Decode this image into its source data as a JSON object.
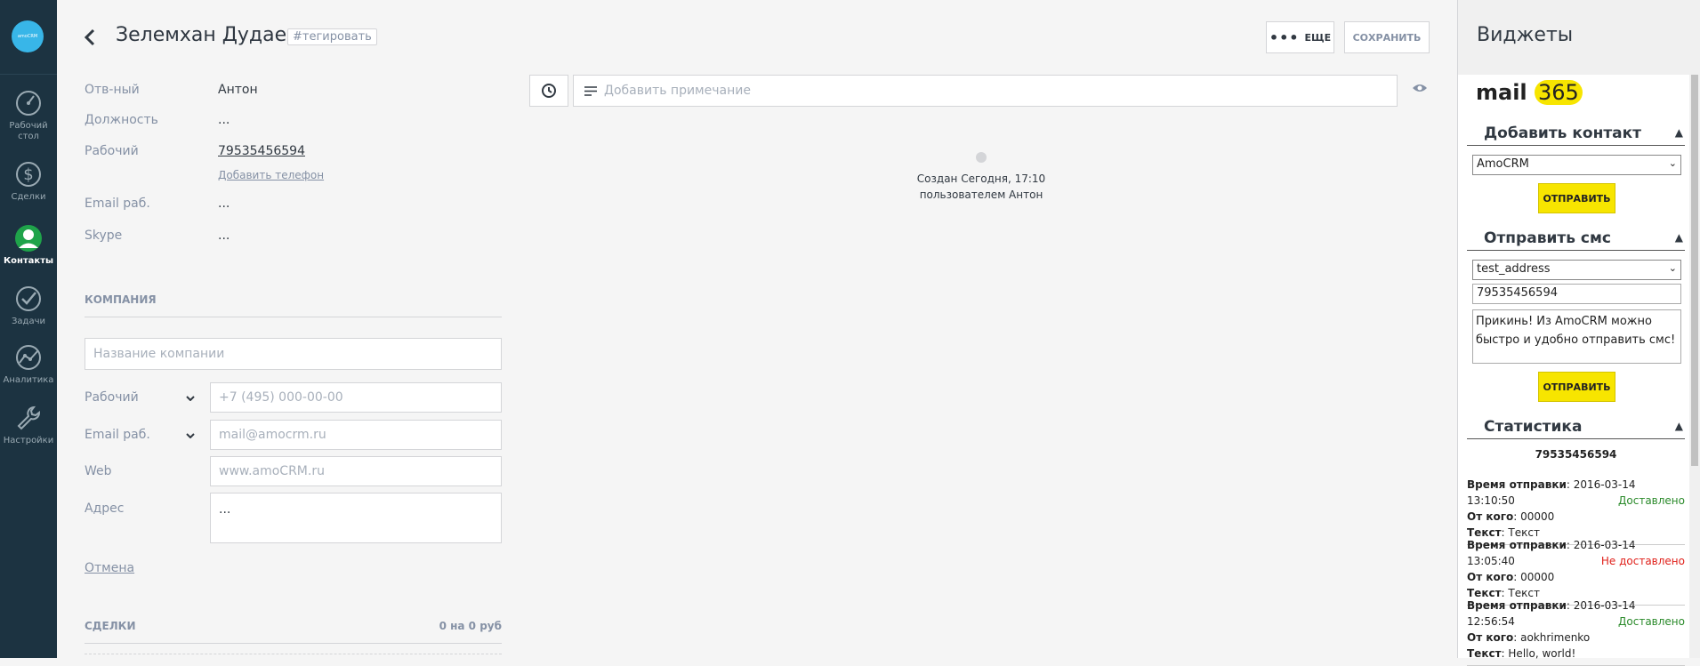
{
  "nav": {
    "logo_text": "amoCRM",
    "items": [
      {
        "label": "Рабочий стол",
        "icon": "dashboard-icon"
      },
      {
        "label": "Сделки",
        "icon": "dollar-icon"
      },
      {
        "label": "Контакты",
        "icon": "contact-icon"
      },
      {
        "label": "Задачи",
        "icon": "check-icon"
      },
      {
        "label": "Аналитика",
        "icon": "analytics-icon"
      },
      {
        "label": "Настройки",
        "icon": "wrench-icon"
      }
    ],
    "active_item": "Контакты"
  },
  "contact": {
    "name": "Зелемхан Дудаев",
    "tag_link": "#тегировать",
    "fields": [
      {
        "label": "Отв-ный",
        "value": "Антон"
      },
      {
        "label": "Должность",
        "value": "..."
      },
      {
        "label": "Рабочий",
        "value": "79535456594"
      },
      {
        "label": "Email раб.",
        "value": "..."
      },
      {
        "label": "Skype",
        "value": "..."
      }
    ],
    "add_phone": "Добавить телефон"
  },
  "company": {
    "heading": "КОМПАНИЯ",
    "name_placeholder": "Название компании",
    "phone_label": "Рабочий",
    "phone_placeholder": "+7 (495) 000-00-00",
    "email_label": "Email раб.",
    "email_placeholder": "mail@amocrm.ru",
    "web_label": "Web",
    "web_placeholder": "www.amoCRM.ru",
    "address_label": "Адрес",
    "address_value": "...",
    "cancel": "Отмена"
  },
  "deals": {
    "heading": "СДЕЛКИ",
    "summary": "0 на 0 руб"
  },
  "toolbar": {
    "more_label": "ЕЩЕ",
    "save_label": "СОХРАНИТЬ"
  },
  "feed": {
    "note_placeholder": "Добавить примечание",
    "created_line1": "Создан Сегодня, 17:10",
    "created_line2": "пользователем Антон"
  },
  "widgets": {
    "title": "Виджеты",
    "logo_word": "mail",
    "logo_num": "365",
    "add_contact": {
      "title": "Добавить контакт",
      "select_value": "AmoCRM",
      "button": "ОТПРАВИТЬ"
    },
    "send_sms": {
      "title": "Отправить смс",
      "select_value": "test_address",
      "phone": "79535456594",
      "message": "Прикинь! Из AmoCRM можно быстро и удобно отправить смс!",
      "button": "ОТПРАВИТЬ"
    },
    "stats": {
      "title": "Статистика",
      "number": "79535456594",
      "time_label": "Время отправки",
      "from_label": "От кого",
      "text_label": "Текст",
      "entries": [
        {
          "time": "2016-03-14 13:10:50",
          "from": "00000",
          "status": "Доставлено",
          "text": "Текст"
        },
        {
          "time": "2016-03-14 13:05:40",
          "from": "00000",
          "status": "Не доставлено",
          "text": "Текст"
        },
        {
          "time": "2016-03-14 12:56:54",
          "from": "aokhrimenko",
          "status": "Доставлено",
          "text": "Hello, world!"
        }
      ]
    }
  }
}
